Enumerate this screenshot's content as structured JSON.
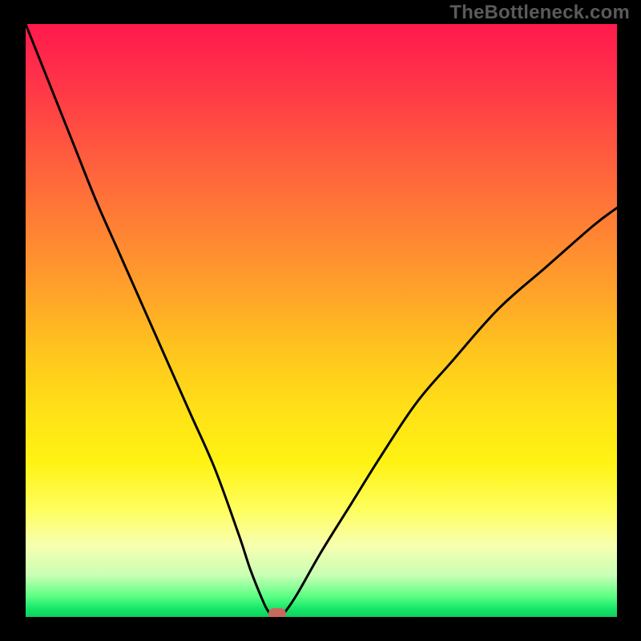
{
  "watermark": "TheBottleneck.com",
  "colors": {
    "frame_bg": "#000000",
    "curve_stroke": "#000000",
    "marker_fill": "#c9685e",
    "gradient_top": "#ff1a4d",
    "gradient_bottom": "#0fcf5f"
  },
  "chart_data": {
    "type": "line",
    "title": "",
    "xlabel": "",
    "ylabel": "",
    "xlim": [
      0,
      100
    ],
    "ylim": [
      0,
      100
    ],
    "grid": false,
    "series": [
      {
        "name": "bottleneck-curve",
        "x": [
          0,
          4,
          8,
          12,
          16,
          20,
          24,
          28,
          32,
          36,
          38,
          40,
          41,
          42,
          43,
          44,
          46,
          50,
          55,
          60,
          66,
          72,
          80,
          88,
          96,
          100
        ],
        "y": [
          100,
          90,
          80,
          70,
          61,
          52,
          43,
          34,
          25,
          14,
          8,
          3,
          1,
          0,
          0,
          1,
          4,
          11,
          19,
          27,
          36,
          43,
          52,
          59,
          66,
          69
        ]
      }
    ],
    "annotations": [
      {
        "name": "minimum-marker",
        "x": 42.5,
        "y": 0
      }
    ],
    "background_gradient": {
      "direction": "vertical",
      "meaning_top": "severe bottleneck",
      "meaning_bottom": "no bottleneck",
      "stops": [
        {
          "pct": 0,
          "color": "#ff1a4d"
        },
        {
          "pct": 45,
          "color": "#ffa22a"
        },
        {
          "pct": 74,
          "color": "#fff313"
        },
        {
          "pct": 97,
          "color": "#5cff84"
        },
        {
          "pct": 100,
          "color": "#0fcf5f"
        }
      ]
    }
  }
}
